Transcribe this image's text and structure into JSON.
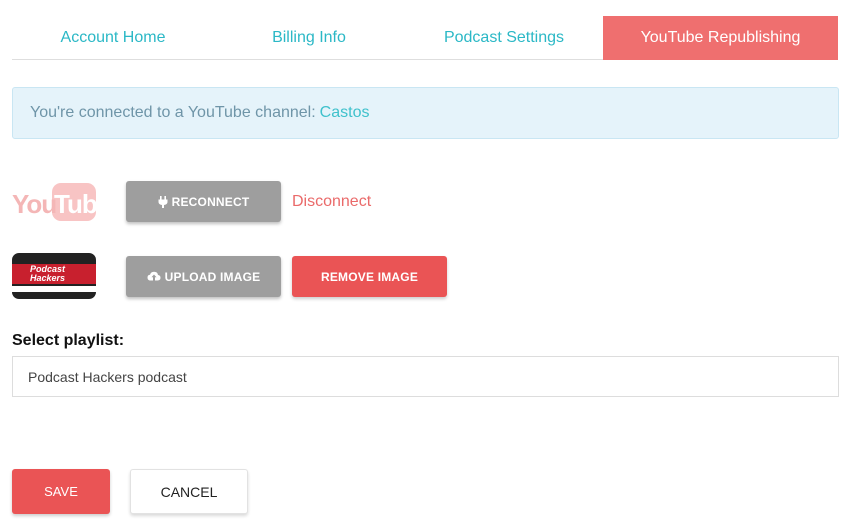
{
  "tabs": [
    {
      "label": "Account Home"
    },
    {
      "label": "Billing Info"
    },
    {
      "label": "Podcast Settings"
    },
    {
      "label": "YouTube Republishing"
    }
  ],
  "notice": {
    "text": "You're connected to a YouTube channel:",
    "channel": "Castos"
  },
  "youtube": {
    "logo_you": "You",
    "logo_tube": "Tube",
    "reconnect_label": "RECONNECT",
    "disconnect_label": "Disconnect"
  },
  "image": {
    "thumb_title_line1": "Podcast",
    "thumb_title_line2": "Hackers",
    "upload_label": "UPLOAD IMAGE",
    "remove_label": "REMOVE IMAGE"
  },
  "playlist": {
    "label": "Select playlist:",
    "value": "Podcast Hackers podcast"
  },
  "footer": {
    "save_label": "SAVE",
    "cancel_label": "CANCEL"
  },
  "colors": {
    "accent_teal": "#2bb8c6",
    "active_tab": "#ef6f6f",
    "danger": "#ea5455",
    "notice_bg": "#e5f3fa"
  }
}
